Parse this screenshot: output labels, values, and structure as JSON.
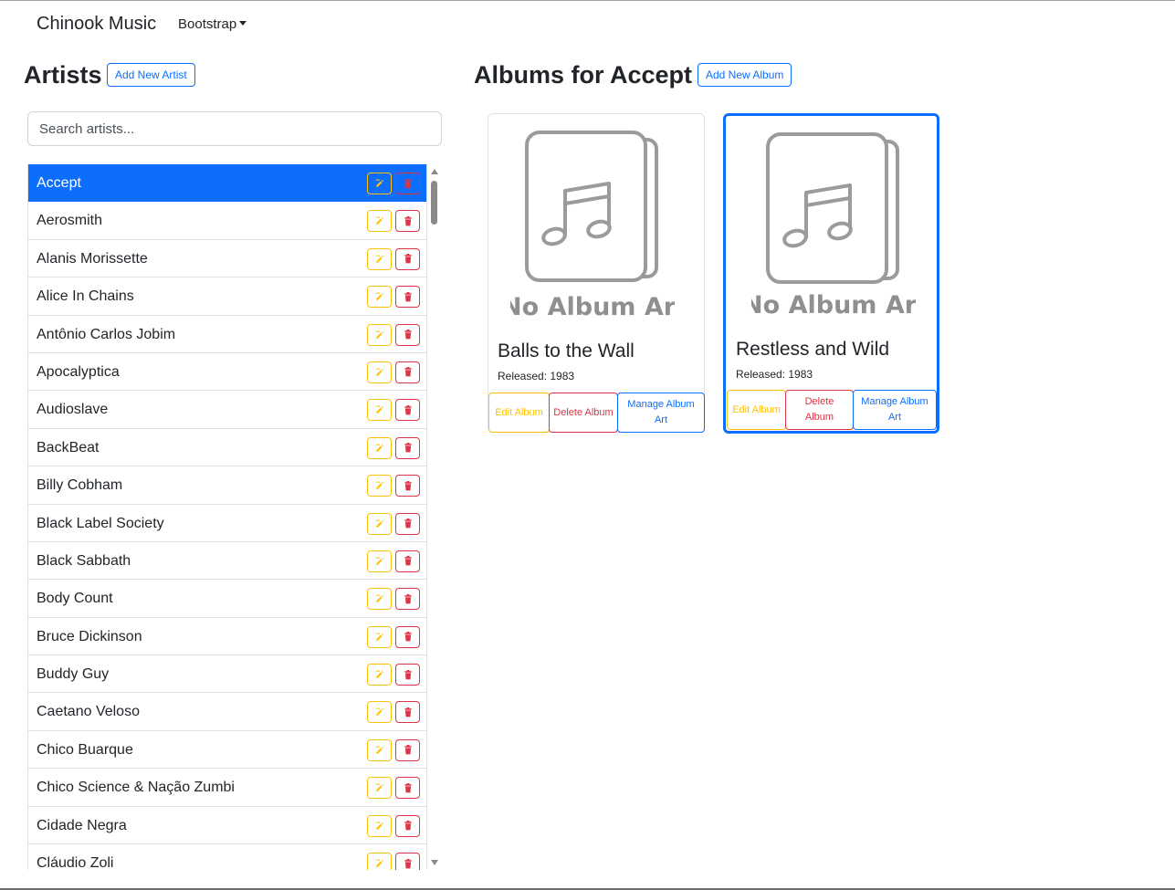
{
  "navbar": {
    "brand": "Chinook Music",
    "dropdown_label": "Bootstrap"
  },
  "artists_panel": {
    "heading": "Artists",
    "add_button": "Add New Artist",
    "search_placeholder": "Search artists...",
    "selected": "Accept",
    "items": [
      "Accept",
      "Aerosmith",
      "Alanis Morissette",
      "Alice In Chains",
      "Antônio Carlos Jobim",
      "Apocalyptica",
      "Audioslave",
      "BackBeat",
      "Billy Cobham",
      "Black Label Society",
      "Black Sabbath",
      "Body Count",
      "Bruce Dickinson",
      "Buddy Guy",
      "Caetano Veloso",
      "Chico Buarque",
      "Chico Science & Nação Zumbi",
      "Cidade Negra",
      "Cláudio Zoli"
    ],
    "row_icons": [
      "edit-icon",
      "trash-icon"
    ]
  },
  "albums_panel": {
    "heading": "Albums for Accept",
    "add_button": "Add New Album",
    "placeholder_art_text": "No Album Art",
    "albums": [
      {
        "title": "Balls to the Wall",
        "released": "Released: 1983",
        "edit_label": "Edit Album",
        "delete_label": "Delete Album",
        "manage_label": "Manage Album Art",
        "selected": false
      },
      {
        "title": "Restless and Wild",
        "released": "Released: 1983",
        "edit_label": "Edit Album",
        "delete_label": "Delete Album",
        "manage_label": "Manage Album Art",
        "selected": true
      }
    ]
  },
  "colors": {
    "primary": "#0d6efd",
    "warning": "#ffc107",
    "danger": "#dc3545"
  }
}
